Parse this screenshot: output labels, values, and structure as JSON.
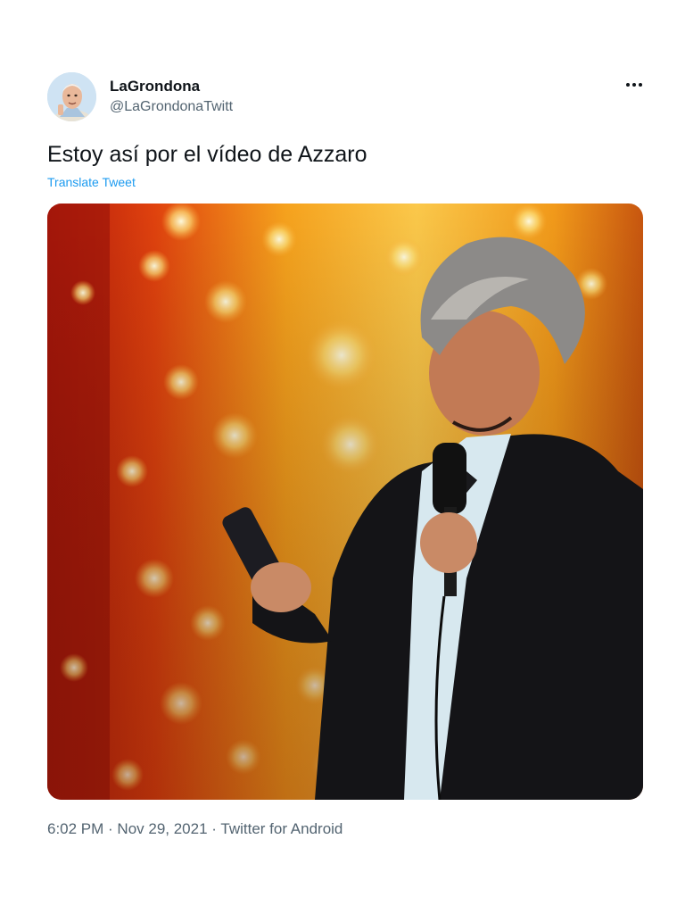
{
  "tweet": {
    "display_name": "LaGrondona",
    "handle": "@LaGrondonaTwitt",
    "text": "Estoy así por el vídeo de Azzaro",
    "translate_label": "Translate Tweet",
    "more_label": "···",
    "time": "6:02 PM",
    "separator": " · ",
    "date": "Nov 29, 2021",
    "source": "Twitter for Android"
  },
  "colors": {
    "text_primary": "#0f1419",
    "text_secondary": "#536471",
    "link": "#1d9bf0",
    "background": "#ffffff"
  },
  "icons": {
    "more": "more-horizontal-icon"
  }
}
